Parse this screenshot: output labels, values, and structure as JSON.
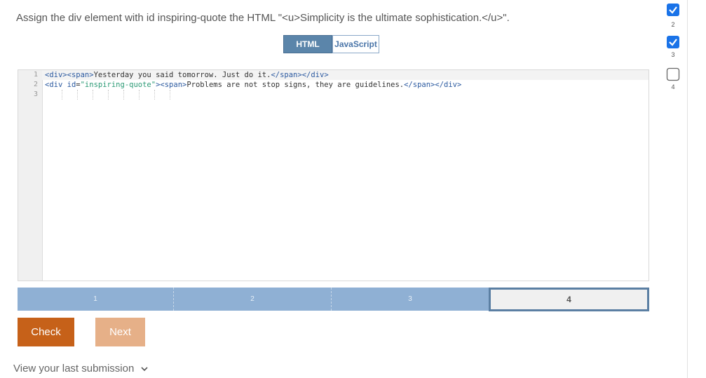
{
  "instruction": "Assign the div element with id inspiring-quote the HTML \"<u>Simplicity is the ultimate sophistication.</u>\".",
  "tabs": [
    {
      "label": "HTML",
      "active": true
    },
    {
      "label": "JavaScript",
      "active": false
    }
  ],
  "editor": {
    "line_numbers": [
      "1",
      "2",
      "3"
    ],
    "lines": [
      "<div><span>Yesterday you said tomorrow. Just do it.</span></div>",
      "<div id=\"inspiring-quote\"><span>Problems are not stop signs, they are guidelines.</span></div>",
      ""
    ]
  },
  "progress": {
    "segments": [
      "1",
      "2",
      "3",
      "4"
    ],
    "current": "4"
  },
  "buttons": {
    "check": "Check",
    "next": "Next"
  },
  "last_submission": "View your last submission",
  "sidebar": {
    "items": [
      {
        "label": "",
        "state": "completed"
      },
      {
        "label": "2",
        "state": "completed"
      },
      {
        "label": "3",
        "state": "current"
      },
      {
        "label": "4",
        "state": "todo"
      }
    ]
  },
  "colors": {
    "accent": "#c66119",
    "next_button": "#e6b088",
    "progress_fill": "#8fb0d4",
    "tab_active": "#5b85aa",
    "check_icon": "#1a73e8"
  }
}
